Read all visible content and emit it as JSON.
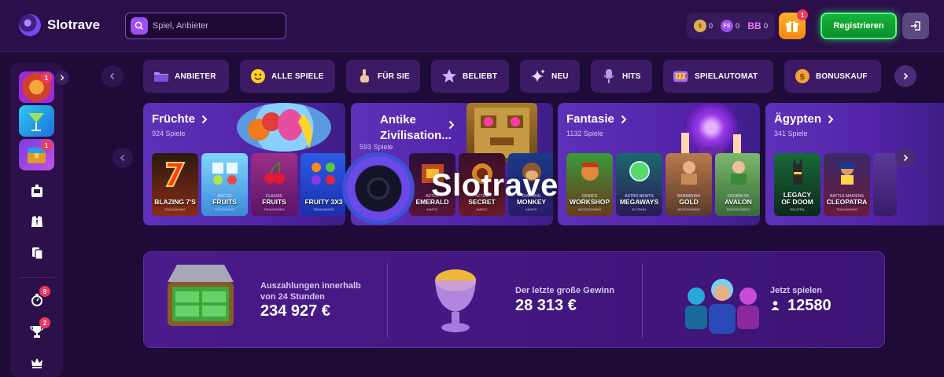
{
  "header": {
    "brand": "Slotrave",
    "search_placeholder": "Spiel, Anbieter",
    "balances": [
      {
        "icon": "coin-icon",
        "value": "0"
      },
      {
        "icon": "free-spins-icon",
        "label": "FS",
        "value": "0"
      },
      {
        "icon": "bonus-balance-icon",
        "label": "BB",
        "value": "0"
      }
    ],
    "gift_badge": "1",
    "register_label": "Registrieren"
  },
  "sidebar": {
    "badges": {
      "top": "1",
      "third": "1",
      "stopwatch": "9",
      "trophy": "2"
    }
  },
  "categories": [
    {
      "label": "ANBIETER",
      "icon": "folder-icon"
    },
    {
      "label": "ALLE SPIELE",
      "icon": "smiley-icon"
    },
    {
      "label": "FÜR SIE",
      "icon": "hand-icon"
    },
    {
      "label": "BELIEBT",
      "icon": "star-icon"
    },
    {
      "label": "NEU",
      "icon": "sparkle-icon"
    },
    {
      "label": "HITS",
      "icon": "microphone-icon"
    },
    {
      "label": "SPIELAUTOMAT",
      "icon": "slot-machine-icon"
    },
    {
      "label": "BONUSKAUF",
      "icon": "coin-bag-icon"
    }
  ],
  "collections": [
    {
      "title": "Früchte",
      "count": "924 Spiele",
      "games": [
        {
          "small": "",
          "name": "BLAZING 7'S",
          "provider": "TADAGAMING"
        },
        {
          "small": "ARCTIC",
          "name": "FRUITS",
          "provider": "TADAGAMING"
        },
        {
          "small": "CLASSIC",
          "name": "FRUITS",
          "provider": "TADAGAMING"
        },
        {
          "small": "",
          "name": "FRUITY 3X3",
          "provider": "TADAGAMING"
        }
      ]
    },
    {
      "title": "Antike Zivilisation...",
      "count": "593 Spiele",
      "games": [
        {
          "small": "AZTEC",
          "name": "EMERALD",
          "provider": "AMATIC"
        },
        {
          "small": "AZTEC",
          "name": "SECRET",
          "provider": "AMATIC"
        },
        {
          "small": "DIAMOND",
          "name": "MONKEY",
          "provider": "AMATIC"
        }
      ]
    },
    {
      "title": "Fantasie",
      "count": "1132 Spiele",
      "games": [
        {
          "small": "GENIE'S",
          "name": "WORKSHOP",
          "provider": "MICROGAMING"
        },
        {
          "small": "ASTRO NEWTS",
          "name": "MEGAWAYS",
          "provider": "SLOTMILL"
        },
        {
          "small": "BARBARIAN",
          "name": "GOLD",
          "provider": "MICROGAMING"
        },
        {
          "small": "CROWN OF",
          "name": "AVALON",
          "provider": "MICROGAMING"
        }
      ]
    },
    {
      "title": "Ägypten",
      "count": "341 Spiele",
      "games": [
        {
          "small": "LEGACY",
          "name": "OF DOOM",
          "provider": "BELATRA"
        },
        {
          "small": "BATTLE MAIDENS",
          "name": "CLEOPATRA",
          "provider": "TADAGAMING"
        }
      ]
    }
  ],
  "watermark": "Slotrave",
  "stats": [
    {
      "label": "Auszahlungen innerhalb von 24 Stunden",
      "value": "234 927 €"
    },
    {
      "label": "Der letzte große Gewinn",
      "value": "28 313 €"
    },
    {
      "label": "Jetzt spielen",
      "value": "12580"
    }
  ],
  "colors": {
    "background": "#1f0b38",
    "header": "#2a0f4a",
    "accent": "#a24cf5",
    "register": "#14b53b"
  }
}
